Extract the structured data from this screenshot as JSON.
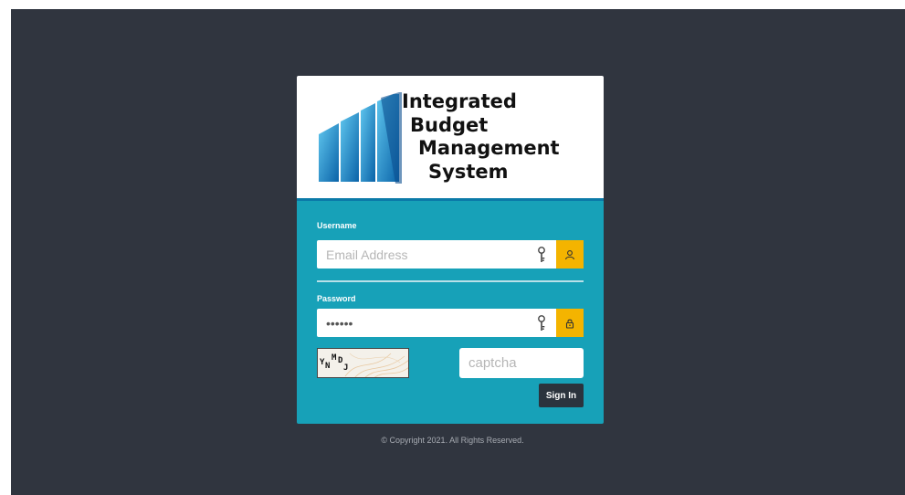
{
  "logo": {
    "line1": "Integrated",
    "line2": "Budget",
    "line3": "Management",
    "line4": "System"
  },
  "form": {
    "username_label": "Username",
    "username_placeholder": "Email Address",
    "password_label": "Password",
    "password_value": "******",
    "captcha_code": "YNMDJ",
    "captcha_placeholder": "captcha",
    "signin_label": "Sign In"
  },
  "icons": {
    "username_field": "key-icon",
    "username_addon": "user-icon",
    "password_field": "key-icon",
    "password_addon": "lock-icon"
  },
  "footer": {
    "copyright": "© Copyright 2021. All Rights Reserved."
  },
  "colors": {
    "background": "#30353f",
    "form_panel": "#17a1b8",
    "addon": "#f4b400",
    "button": "#2b333d",
    "logo_blue": "#0b7aa8"
  }
}
